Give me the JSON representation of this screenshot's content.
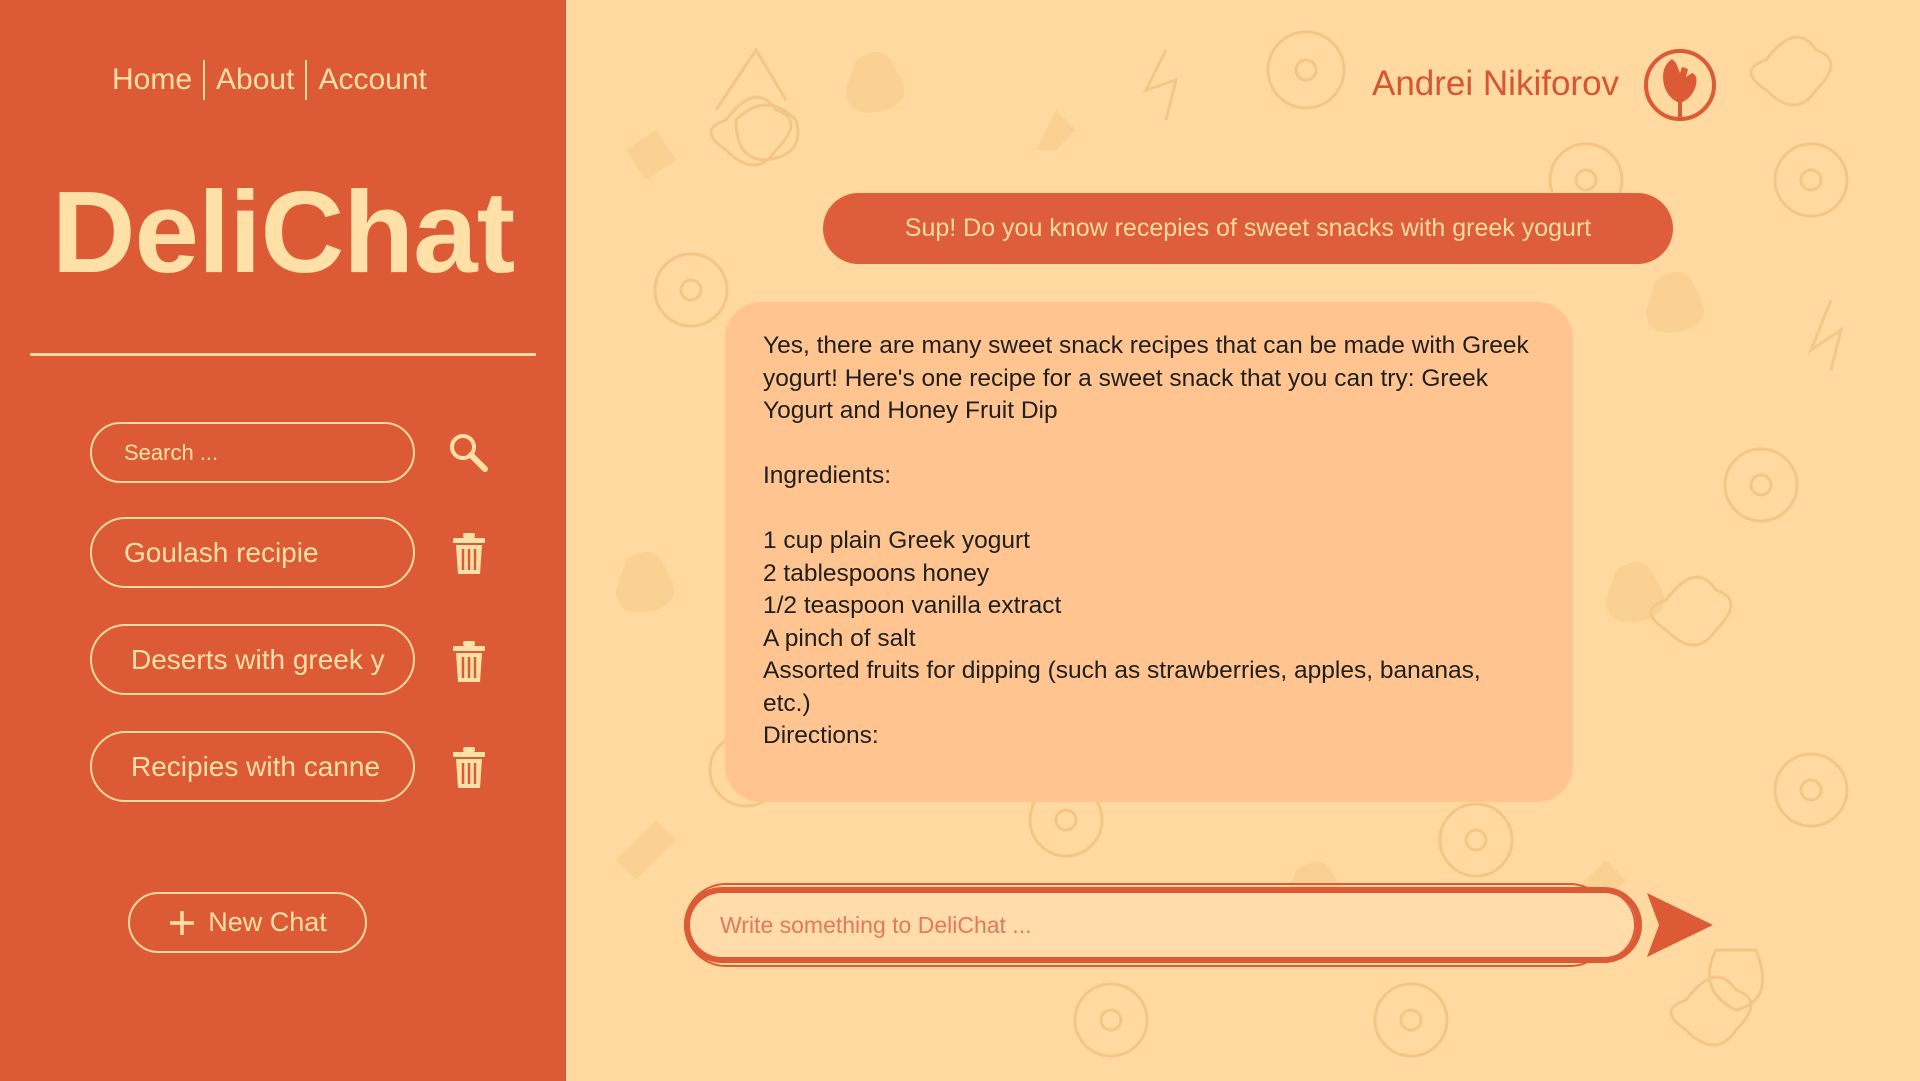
{
  "nav": {
    "links": [
      {
        "label": "Home"
      },
      {
        "label": "About"
      },
      {
        "label": "Account"
      }
    ]
  },
  "app": {
    "title": "DeliChat"
  },
  "search": {
    "placeholder": "Search ...",
    "icon": "search-icon"
  },
  "chats": [
    {
      "label": "Goulash recipie",
      "icon": "trash-icon"
    },
    {
      "label": "Deserts with greek y",
      "icon": "trash-icon"
    },
    {
      "label": "Recipies with canne",
      "icon": "trash-icon"
    }
  ],
  "new_chat": {
    "label": "New Chat",
    "icon": "plus-icon"
  },
  "user": {
    "name": "Andrei Nikiforov",
    "avatar_icon": "vegetable-avatar-icon"
  },
  "conversation": {
    "user_message": "Sup! Do you know recepies of sweet snacks with greek yogurt",
    "bot_message": {
      "intro": "Yes, there are many sweet snack recipes that can be made with Greek yogurt! Here's one recipe for a sweet snack that you can try: Greek Yogurt and Honey Fruit Dip",
      "ingredients_heading": "Ingredients:",
      "ingredients": [
        "1 cup plain Greek yogurt",
        "2 tablespoons honey",
        "1/2 teaspoon vanilla extract",
        "A pinch of salt",
        "Assorted fruits for dipping (such as strawberries, apples, bananas, etc.)"
      ],
      "directions_heading": "Directions:"
    }
  },
  "composer": {
    "placeholder": "Write something to DeliChat ...",
    "send_icon": "send-arrow-icon"
  },
  "colors": {
    "sidebar": "#dd5a36",
    "background": "#ffd9a0",
    "accent_text": "#ffe0a6",
    "bot_bubble": "#ffc490",
    "user_bubble": "#de5d3b"
  }
}
